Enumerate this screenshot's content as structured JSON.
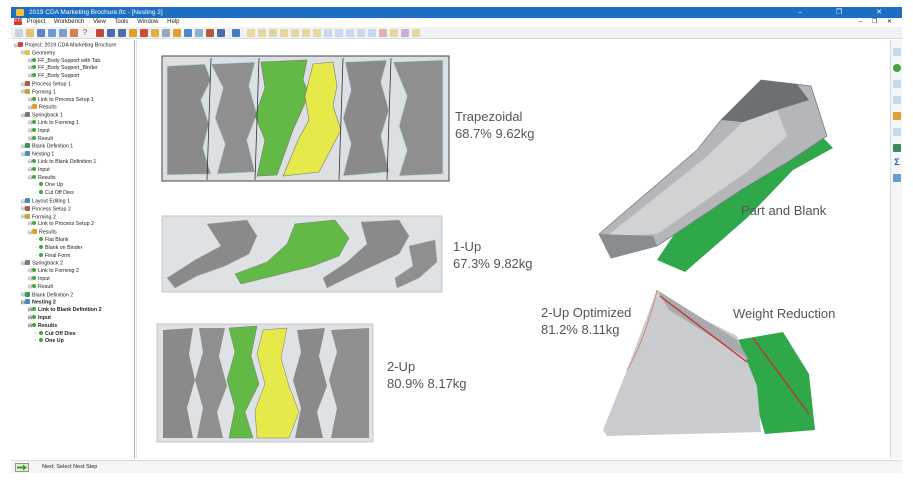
{
  "window": {
    "title": "2019 CDA Marketing Brochure.ftc - [Nesting 2]",
    "controls": "–   ❐   ✕"
  },
  "menu": {
    "app_mark": "FTI",
    "items": [
      "Project",
      "Workbench",
      "View",
      "Tools",
      "Window",
      "Help"
    ],
    "mdi_controls": "– ❐ ✕"
  },
  "tree": {
    "nodes": [
      {
        "label": "Project: 2019 CDA Marketing Brochure",
        "indent": 0,
        "icon": "project-icon",
        "color": "#c8473c",
        "bold": false
      },
      {
        "label": "Geometry",
        "indent": 1,
        "icon": "geometry-folder-icon",
        "color": "#e8c04a",
        "bold": false
      },
      {
        "label": "FF_Body Support with Tab",
        "indent": 2,
        "icon": "dot",
        "color": "#3fa63f",
        "bold": false
      },
      {
        "label": "FF_Body Support_Binder",
        "indent": 2,
        "icon": "dot",
        "color": "#3fa63f",
        "bold": false
      },
      {
        "label": "FF_Body Support",
        "indent": 2,
        "icon": "dot",
        "color": "#3fa63f",
        "bold": false
      },
      {
        "label": "Process Setup 1",
        "indent": 1,
        "icon": "process-setup-icon",
        "color": "#b45a3a",
        "bold": false
      },
      {
        "label": "Forming 1",
        "indent": 1,
        "icon": "forming-icon",
        "color": "#c9a43a",
        "bold": false
      },
      {
        "label": "Link to Process Setup 1",
        "indent": 2,
        "icon": "dot",
        "color": "#3fa63f",
        "bold": false
      },
      {
        "label": "Results",
        "indent": 2,
        "icon": "results-icon",
        "color": "#e0a030",
        "bold": false
      },
      {
        "label": "Springback 1",
        "indent": 1,
        "icon": "springback-icon",
        "color": "#7a7a7a",
        "bold": false
      },
      {
        "label": "Link to Forming 1",
        "indent": 2,
        "icon": "dot",
        "color": "#3fa63f",
        "bold": false
      },
      {
        "label": "Input",
        "indent": 2,
        "icon": "dot",
        "color": "#3fa63f",
        "bold": false
      },
      {
        "label": "Result",
        "indent": 2,
        "icon": "dot",
        "color": "#3fa63f",
        "bold": false
      },
      {
        "label": "Blank Definition 1",
        "indent": 1,
        "icon": "blank-definition-icon",
        "color": "#3a9a5a",
        "bold": false
      },
      {
        "label": "Nesting 1",
        "indent": 1,
        "icon": "nesting-icon",
        "color": "#4a8ac8",
        "bold": false
      },
      {
        "label": "Link to Blank Definition 1",
        "indent": 2,
        "icon": "dot",
        "color": "#3fa63f",
        "bold": false
      },
      {
        "label": "Input",
        "indent": 2,
        "icon": "dot",
        "color": "#3fa63f",
        "bold": false
      },
      {
        "label": "Results",
        "indent": 2,
        "icon": "dot",
        "color": "#3fa63f",
        "bold": false
      },
      {
        "label": "One Up",
        "indent": 3,
        "icon": "dot",
        "color": "#3fa63f",
        "bold": false
      },
      {
        "label": "Cut Off Dies",
        "indent": 3,
        "icon": "dot",
        "color": "#3fa63f",
        "bold": false
      },
      {
        "label": "Layout Editing 1",
        "indent": 1,
        "icon": "layout-editing-icon",
        "color": "#4a8ac8",
        "bold": false
      },
      {
        "label": "Process Setup 2",
        "indent": 1,
        "icon": "process-setup-icon",
        "color": "#b45a3a",
        "bold": false
      },
      {
        "label": "Forming 2",
        "indent": 1,
        "icon": "forming-icon",
        "color": "#c9a43a",
        "bold": false
      },
      {
        "label": "Link to Process Setup 2",
        "indent": 2,
        "icon": "dot",
        "color": "#3fa63f",
        "bold": false
      },
      {
        "label": "Results",
        "indent": 2,
        "icon": "results-icon",
        "color": "#e0a030",
        "bold": false
      },
      {
        "label": "Flat Blank",
        "indent": 3,
        "icon": "dot",
        "color": "#3fa63f",
        "bold": false
      },
      {
        "label": "Blank on Binder",
        "indent": 3,
        "icon": "dot",
        "color": "#3fa63f",
        "bold": false
      },
      {
        "label": "Final Form",
        "indent": 3,
        "icon": "dot",
        "color": "#3fa63f",
        "bold": false
      },
      {
        "label": "Springback 2",
        "indent": 1,
        "icon": "springback-icon",
        "color": "#7a7a7a",
        "bold": false
      },
      {
        "label": "Link to Forming 2",
        "indent": 2,
        "icon": "dot",
        "color": "#3fa63f",
        "bold": false
      },
      {
        "label": "Input",
        "indent": 2,
        "icon": "dot",
        "color": "#3fa63f",
        "bold": false
      },
      {
        "label": "Result",
        "indent": 2,
        "icon": "dot",
        "color": "#3fa63f",
        "bold": false
      },
      {
        "label": "Blank Definition 2",
        "indent": 1,
        "icon": "blank-definition-icon",
        "color": "#3a9a5a",
        "bold": false
      },
      {
        "label": "Nesting 2",
        "indent": 1,
        "icon": "nesting-icon",
        "color": "#4a8ac8",
        "bold": true
      },
      {
        "label": "Link to Blank Definition 2",
        "indent": 2,
        "icon": "dot",
        "color": "#3fa63f",
        "bold": true
      },
      {
        "label": "Input",
        "indent": 2,
        "icon": "dot",
        "color": "#3fa63f",
        "bold": true
      },
      {
        "label": "Results",
        "indent": 2,
        "icon": "dot",
        "color": "#3fa63f",
        "bold": true
      },
      {
        "label": "Cut Off Dies",
        "indent": 3,
        "icon": "dot",
        "color": "#3fa63f",
        "bold": true
      },
      {
        "label": "One Up",
        "indent": 3,
        "icon": "dot",
        "color": "#3fa63f",
        "bold": true
      }
    ]
  },
  "labels": {
    "trap_title": "Trapezoidal",
    "trap_stats": "68.7%  9.62kg",
    "oneup_title": "1-Up",
    "oneup_stats": "67.3% 9.82kg",
    "twoup_title": "2-Up",
    "twoup_stats": "80.9% 8.17kg",
    "part_blank": "Part and Blank",
    "opt_title": "2-Up Optimized",
    "opt_stats": "81.2% 8.11kg",
    "weight_reduction": "Weight Reduction"
  },
  "status": {
    "text": "Next: Select Next Step"
  },
  "colors": {
    "titlebar": "#1b6ec2",
    "part_gray": "#8a8a8a",
    "part_green": "#62b946",
    "part_yellow": "#e6e94a",
    "blank_green": "#2fa84a",
    "cut_line": "#cc2b2b"
  }
}
